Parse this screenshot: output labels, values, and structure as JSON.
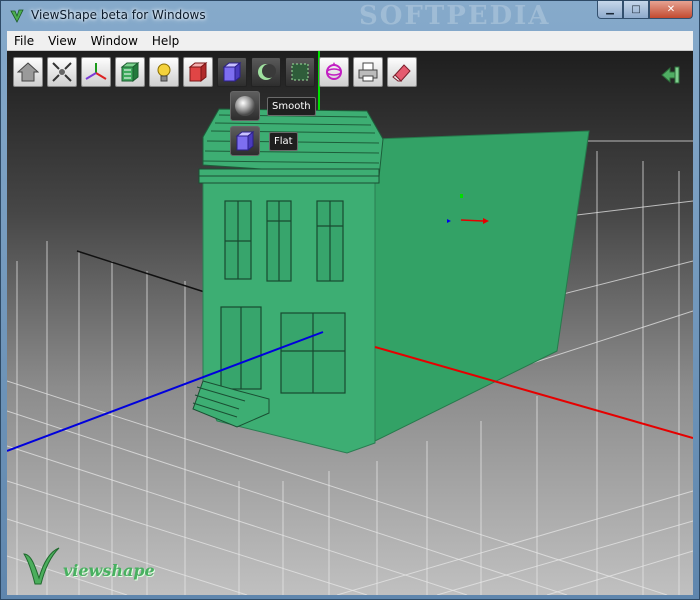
{
  "window": {
    "title": "ViewShape beta for Windows",
    "watermark": "SOFTPEDIA",
    "controls": {
      "minimize": "▁",
      "maximize": "□",
      "close": "✕"
    }
  },
  "menu": [
    "File",
    "View",
    "Window",
    "Help"
  ],
  "toolbar": {
    "tools": [
      "home-icon",
      "fit-view-icon",
      "axes-icon",
      "texture-cube-icon",
      "light-bulb-icon",
      "solid-cube-icon",
      "shading-cube-icon",
      "moon-icon",
      "selection-icon",
      "rotate-gizmo-icon",
      "printer-icon",
      "eraser-icon"
    ]
  },
  "shading_menu": {
    "options": [
      {
        "label": "Smooth",
        "icon": "sphere-icon"
      },
      {
        "label": "Flat",
        "icon": "flat-cube-icon"
      }
    ]
  },
  "branding": {
    "logo_text": "viewshape"
  },
  "colors": {
    "model": "#3dae73",
    "axis_x": "#e60000",
    "axis_y": "#00ff00",
    "axis_z": "#0000dd"
  }
}
